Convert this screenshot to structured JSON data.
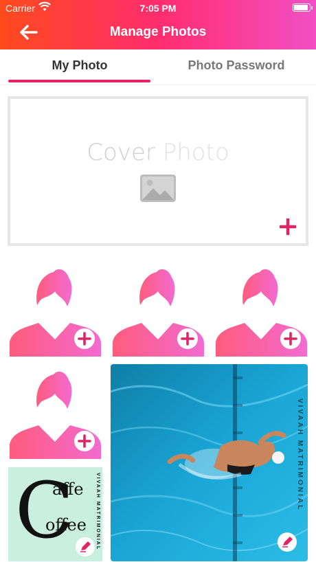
{
  "status_bar": {
    "carrier": "Carrier",
    "time": "7:05 PM"
  },
  "header": {
    "title": "Manage Photos",
    "back_icon": "arrow-left-icon"
  },
  "tabs": [
    {
      "label": "My Photo",
      "active": true
    },
    {
      "label": "Photo Password",
      "active": false
    }
  ],
  "cover": {
    "title_part1": "Cover",
    "title_part2": "Photo",
    "image_icon": "image-placeholder-icon",
    "add_icon": "plus-icon"
  },
  "photos": [
    {
      "type": "placeholder",
      "action_icon": "plus-icon"
    },
    {
      "type": "placeholder",
      "action_icon": "plus-icon"
    },
    {
      "type": "placeholder",
      "action_icon": "plus-icon"
    },
    {
      "type": "placeholder",
      "action_icon": "plus-icon"
    },
    {
      "type": "photo",
      "description_icon": "swimmer-photo",
      "watermark": "VIVAAH MATRIMONIAL",
      "action_icon": "edit-icon"
    },
    {
      "type": "photo",
      "logo_line1": "affe",
      "logo_line2": "offee",
      "logo_letter": "C",
      "watermark": "VIVAAH MATRIMONIAL",
      "action_icon": "edit-icon"
    }
  ],
  "colors": {
    "accent": "#e02464",
    "gradient_start": "#ff4a1c",
    "gradient_end": "#f24fc4",
    "pool": "#1aa6d6"
  }
}
